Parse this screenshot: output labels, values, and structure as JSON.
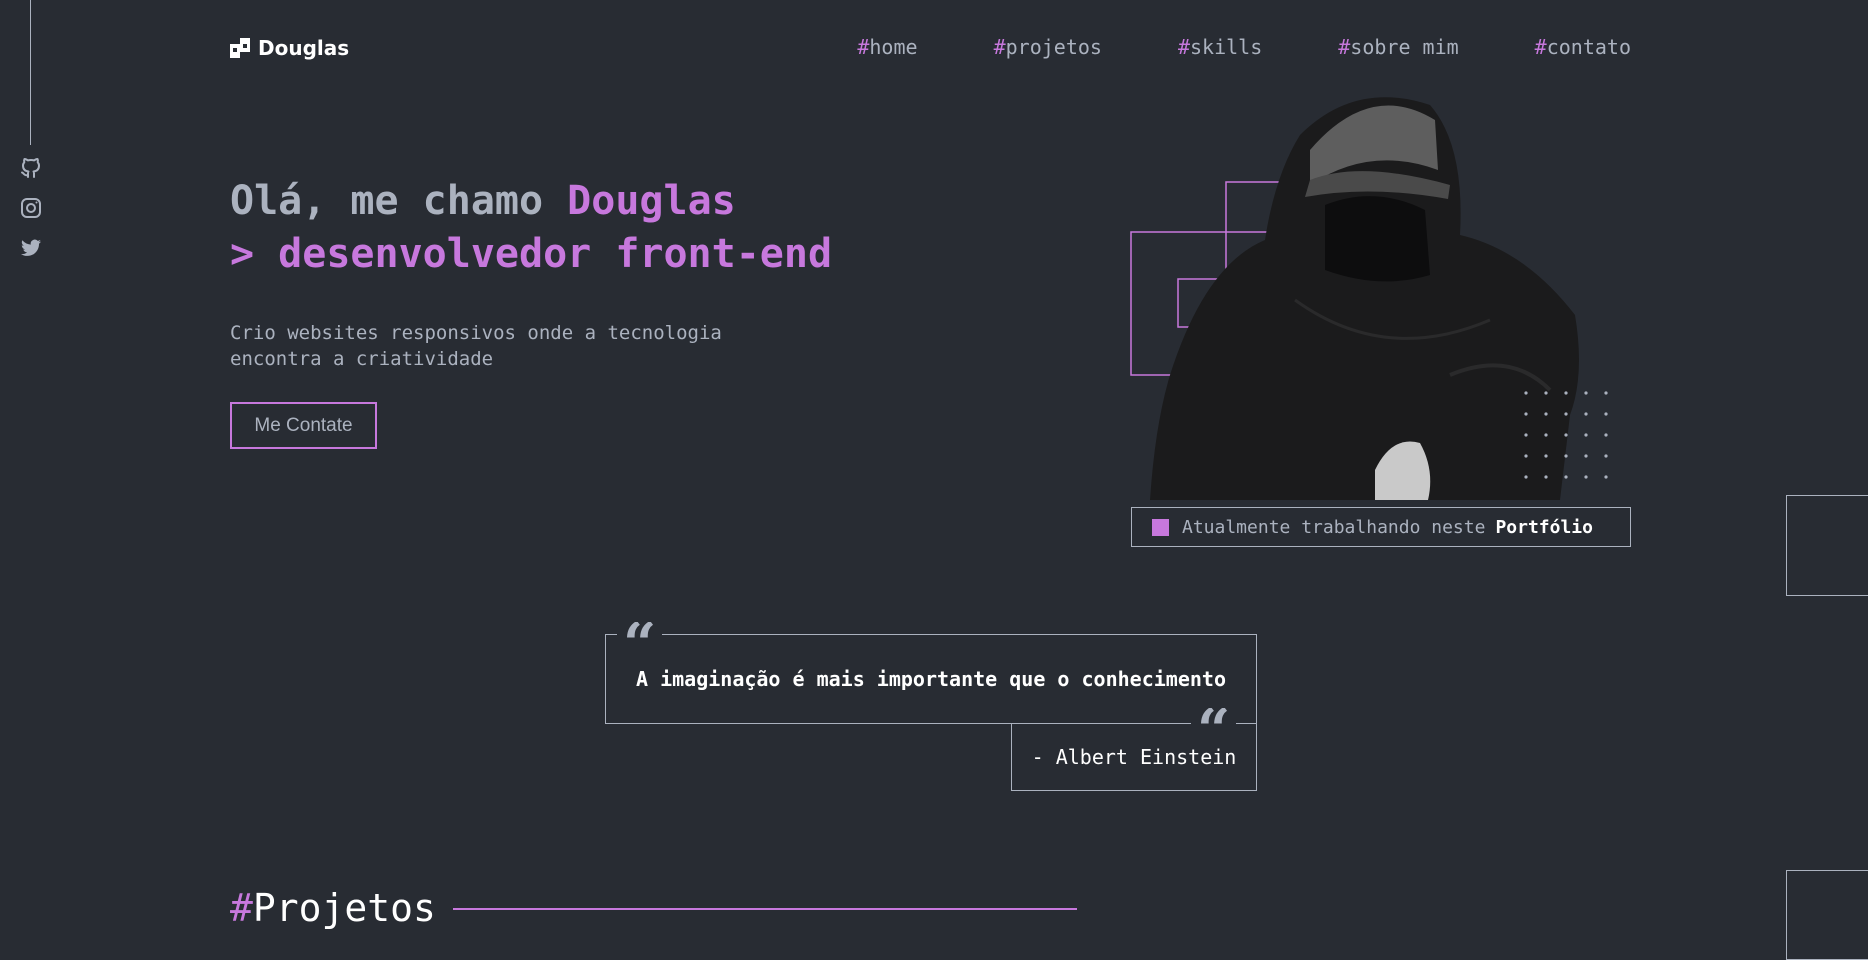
{
  "brand": {
    "name": "Douglas",
    "accent": "#c778dd",
    "background": "#282c33",
    "text": "#abb2bf"
  },
  "social": [
    {
      "name": "github-icon"
    },
    {
      "name": "instagram-icon"
    },
    {
      "name": "twitter-icon"
    }
  ],
  "nav": [
    {
      "hash": "#",
      "label": "home"
    },
    {
      "hash": "#",
      "label": "projetos"
    },
    {
      "hash": "#",
      "label": "skills"
    },
    {
      "hash": "#",
      "label": "sobre mim"
    },
    {
      "hash": "#",
      "label": "contato"
    }
  ],
  "hero": {
    "greeting": "Olá, me chamo ",
    "name": "Douglas",
    "role": "> desenvolvedor front-end",
    "subtitle": "Crio websites responsivos onde a tecnologia encontra a criatividade",
    "cta_label": "Me Contate",
    "status_prefix": "Atualmente trabalhando neste",
    "status_highlight": "Portfólio"
  },
  "quote": {
    "mark": "“",
    "text": "A imaginação é mais importante que o conhecimento",
    "author": "- Albert Einstein"
  },
  "projects": {
    "hash": "#",
    "title": "Projetos"
  }
}
